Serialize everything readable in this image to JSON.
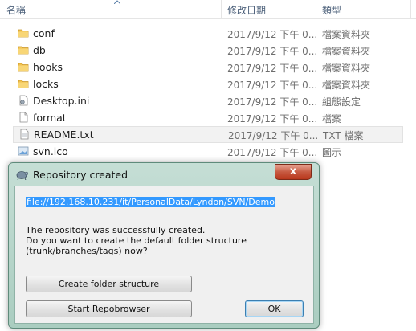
{
  "explorer": {
    "columns": {
      "name": "名稱",
      "date": "修改日期",
      "type": "類型"
    },
    "files": [
      {
        "icon": "folder-icon",
        "name": "conf",
        "date": "2017/9/12 下午 0...",
        "type": "檔案資料夾"
      },
      {
        "icon": "folder-icon",
        "name": "db",
        "date": "2017/9/12 下午 0...",
        "type": "檔案資料夾"
      },
      {
        "icon": "folder-icon",
        "name": "hooks",
        "date": "2017/9/12 下午 0...",
        "type": "檔案資料夾"
      },
      {
        "icon": "folder-icon",
        "name": "locks",
        "date": "2017/9/12 下午 0...",
        "type": "檔案資料夾"
      },
      {
        "icon": "settings-file-icon",
        "name": "Desktop.ini",
        "date": "2017/9/12 下午 0...",
        "type": "組態設定"
      },
      {
        "icon": "file-icon",
        "name": "format",
        "date": "2017/9/12 下午 0...",
        "type": "檔案"
      },
      {
        "icon": "text-file-icon",
        "name": "README.txt",
        "date": "2017/9/12 下午 0...",
        "type": "TXT 檔案"
      },
      {
        "icon": "image-file-icon",
        "name": "svn.ico",
        "date": "2017/9/12 下午 0...",
        "type": "圖示"
      }
    ]
  },
  "dialog": {
    "title": "Repository created",
    "close_label": "x",
    "url": "file://192.168.10.231/it/PersonalData/Lyndon/SVN/Demo",
    "message_lines": [
      "The repository was successfully created.",
      "Do you want to create the default folder structure",
      "(trunk/branches/tags) now?"
    ],
    "buttons": {
      "create": "Create folder structure",
      "repobrowser": "Start Repobrowser",
      "ok": "OK"
    }
  },
  "colors": {
    "folder": "#f2c14e",
    "selection": "#3399ff",
    "dialog_frame": "#aacdc0",
    "close": "#c75a41"
  }
}
